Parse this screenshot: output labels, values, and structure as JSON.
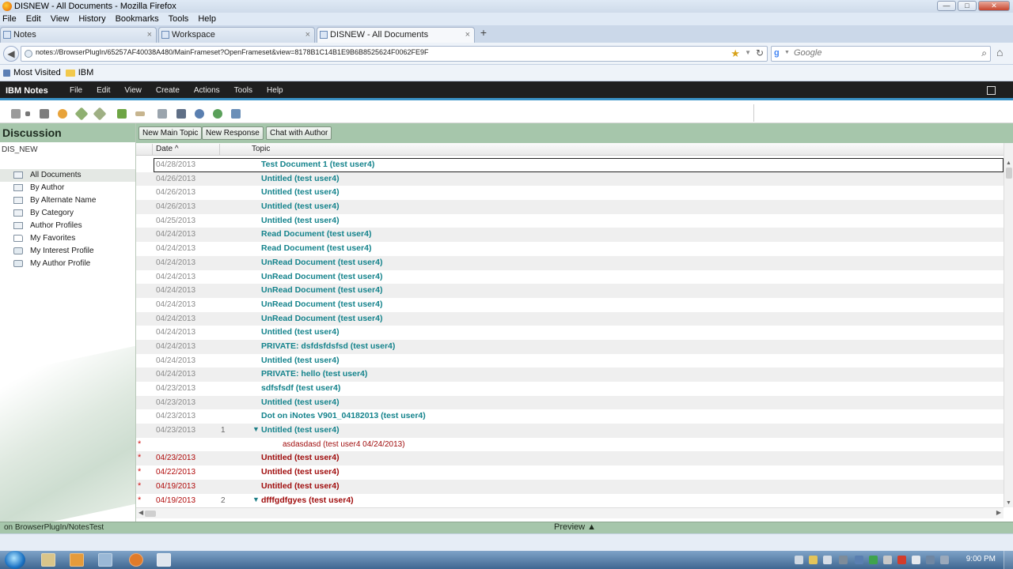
{
  "window": {
    "title": "DISNEW - All Documents - Mozilla Firefox",
    "buttons": [
      "—",
      "□",
      "✕"
    ]
  },
  "menubar": [
    "File",
    "Edit",
    "View",
    "History",
    "Bookmarks",
    "Tools",
    "Help"
  ],
  "tabs": [
    {
      "label": "Notes",
      "active": false
    },
    {
      "label": "Workspace",
      "active": false
    },
    {
      "label": "DISNEW - All Documents",
      "active": true
    }
  ],
  "navigation": {
    "url": "notes://BrowserPlugIn/65257AF40038A480/MainFrameset?OpenFrameset&view=8178B1C14B1E9B6B8525624F0062FE9F",
    "search_placeholder": "Google"
  },
  "bookmarks": [
    "Most Visited",
    "IBM"
  ],
  "notes_app": {
    "brand": "IBM Notes",
    "menus": [
      "File",
      "Edit",
      "View",
      "Create",
      "Actions",
      "Tools",
      "Help"
    ]
  },
  "toolbar_icons": [
    "open-icon",
    "print-icon",
    "stop-icon",
    "edit-icon",
    "pin-icon",
    "forward-icon",
    "back-icon",
    "list-icon",
    "binoculars-icon",
    "search-icon",
    "refresh-icon",
    "database-icon"
  ],
  "left_pane": {
    "title": "Discussion",
    "database": "DIS_NEW",
    "views": [
      {
        "label": "All Documents",
        "icon": "view-icon",
        "selected": true
      },
      {
        "label": "By Author",
        "icon": "view-icon"
      },
      {
        "label": "By Alternate Name",
        "icon": "view-icon"
      },
      {
        "label": "By Category",
        "icon": "view-icon"
      },
      {
        "label": "Author Profiles",
        "icon": "view-icon"
      },
      {
        "label": "My Favorites",
        "icon": "folder-icon"
      },
      {
        "label": "My Interest Profile",
        "icon": "profile-icon"
      },
      {
        "label": "My Author Profile",
        "icon": "profile-icon"
      }
    ]
  },
  "action_bar": {
    "new_main_topic": "New Main Topic",
    "new_response": "New Response",
    "chat_with_author": "Chat with Author"
  },
  "columns": {
    "date": "Date",
    "date_sort": "^",
    "topic": "Topic"
  },
  "rows": [
    {
      "date": "04/28/2013",
      "topic": "Test Document 1 (test user4)",
      "current": true
    },
    {
      "date": "04/26/2013",
      "topic": "Untitled (test user4)"
    },
    {
      "date": "04/26/2013",
      "topic": "Untitled (test user4)"
    },
    {
      "date": "04/26/2013",
      "topic": "Untitled (test user4)"
    },
    {
      "date": "04/25/2013",
      "topic": "Untitled (test user4)"
    },
    {
      "date": "04/24/2013",
      "topic": "Read Document (test user4)"
    },
    {
      "date": "04/24/2013",
      "topic": "Read Document (test user4)"
    },
    {
      "date": "04/24/2013",
      "topic": "UnRead Document (test user4)"
    },
    {
      "date": "04/24/2013",
      "topic": "UnRead Document (test user4)"
    },
    {
      "date": "04/24/2013",
      "topic": "UnRead Document (test user4)"
    },
    {
      "date": "04/24/2013",
      "topic": "UnRead Document (test user4)"
    },
    {
      "date": "04/24/2013",
      "topic": "UnRead Document (test user4)"
    },
    {
      "date": "04/24/2013",
      "topic": "Untitled (test user4)"
    },
    {
      "date": "04/24/2013",
      "topic": "PRIVATE: dsfdsfdsfsd (test user4)"
    },
    {
      "date": "04/24/2013",
      "topic": "Untitled (test user4)"
    },
    {
      "date": "04/24/2013",
      "topic": "PRIVATE: hello (test user4)"
    },
    {
      "date": "04/23/2013",
      "topic": "sdfsfsdf (test user4)"
    },
    {
      "date": "04/23/2013",
      "topic": "Untitled (test user4)"
    },
    {
      "date": "04/23/2013",
      "topic": "Dot on iNotes V901_04182013 (test user4)"
    },
    {
      "date": "04/23/2013",
      "count": "1",
      "twisty": "▼",
      "topic": "Untitled (test user4)"
    },
    {
      "unread": true,
      "response": "asdasdasd  (test user4 04/24/2013)"
    },
    {
      "unread": true,
      "date": "04/23/2013",
      "topic": "Untitled (test user4)"
    },
    {
      "unread": true,
      "date": "04/22/2013",
      "topic": "Untitled (test user4)"
    },
    {
      "unread": true,
      "date": "04/19/2013",
      "topic": "Untitled (test user4)"
    },
    {
      "unread": true,
      "date": "04/19/2013",
      "count": "2",
      "twisty": "▼",
      "topic": "dfffgdfgyes (test user4)"
    }
  ],
  "status": {
    "location": "on BrowserPlugIn/NotesTest",
    "preview": "Preview ▲"
  },
  "taskbar": {
    "clock": "9:00 PM"
  },
  "colors": {
    "accent_green": "#a6c6ab",
    "read_topic": "#14838c",
    "unread_topic": "#a00d0d",
    "notes_header": "#1f1f1f"
  }
}
